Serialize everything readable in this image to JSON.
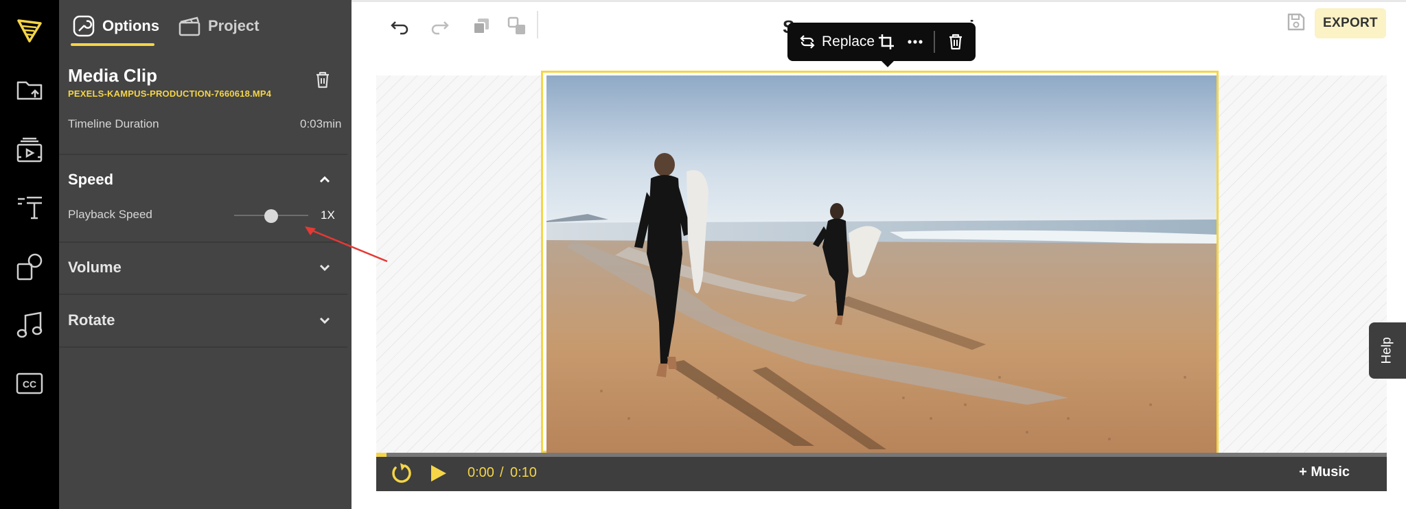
{
  "colors": {
    "accent": "#f5d547",
    "panel_bg": "#444444",
    "rail_bg": "#000000",
    "annotation_red": "#e53935"
  },
  "rail": {
    "items": [
      {
        "icon": "logo-icon"
      },
      {
        "icon": "upload-folder-icon"
      },
      {
        "icon": "media-library-icon"
      },
      {
        "icon": "text-icon"
      },
      {
        "icon": "elements-icon"
      },
      {
        "icon": "music-icon"
      },
      {
        "icon": "subtitles-icon",
        "label": "CC"
      }
    ]
  },
  "tabs": [
    {
      "label": "Options",
      "icon": "options-icon",
      "active": true
    },
    {
      "label": "Project",
      "icon": "project-icon",
      "active": false
    }
  ],
  "clip": {
    "title": "Media Clip",
    "filename": "PEXELS-KAMPUS-PRODUCTION-7660618.MP4",
    "duration_label": "Timeline Duration",
    "duration_value": "0:03min"
  },
  "sections": {
    "speed": {
      "title": "Speed",
      "expanded": true,
      "playback_label": "Playback Speed",
      "value_label": "1X",
      "slider_position": 0.5
    },
    "volume": {
      "title": "Volume",
      "expanded": false
    },
    "rotate": {
      "title": "Rotate",
      "expanded": false
    }
  },
  "toolbar": {
    "tools": [
      "undo-icon",
      "redo-icon",
      "duplicate-icon",
      "arrange-icon"
    ],
    "project_title": "S",
    "project_title_tail": "i"
  },
  "popover": {
    "replace_label": "Replace",
    "icons": [
      "replace-icon",
      "crop-icon",
      "more-icon",
      "delete-icon"
    ]
  },
  "header": {
    "export_label": "EXPORT"
  },
  "help": {
    "label": "Help"
  },
  "playback": {
    "current_time": "0:00",
    "separator": "/",
    "total_time": "0:10",
    "progress": 0.01,
    "music_label": "+ Music"
  }
}
